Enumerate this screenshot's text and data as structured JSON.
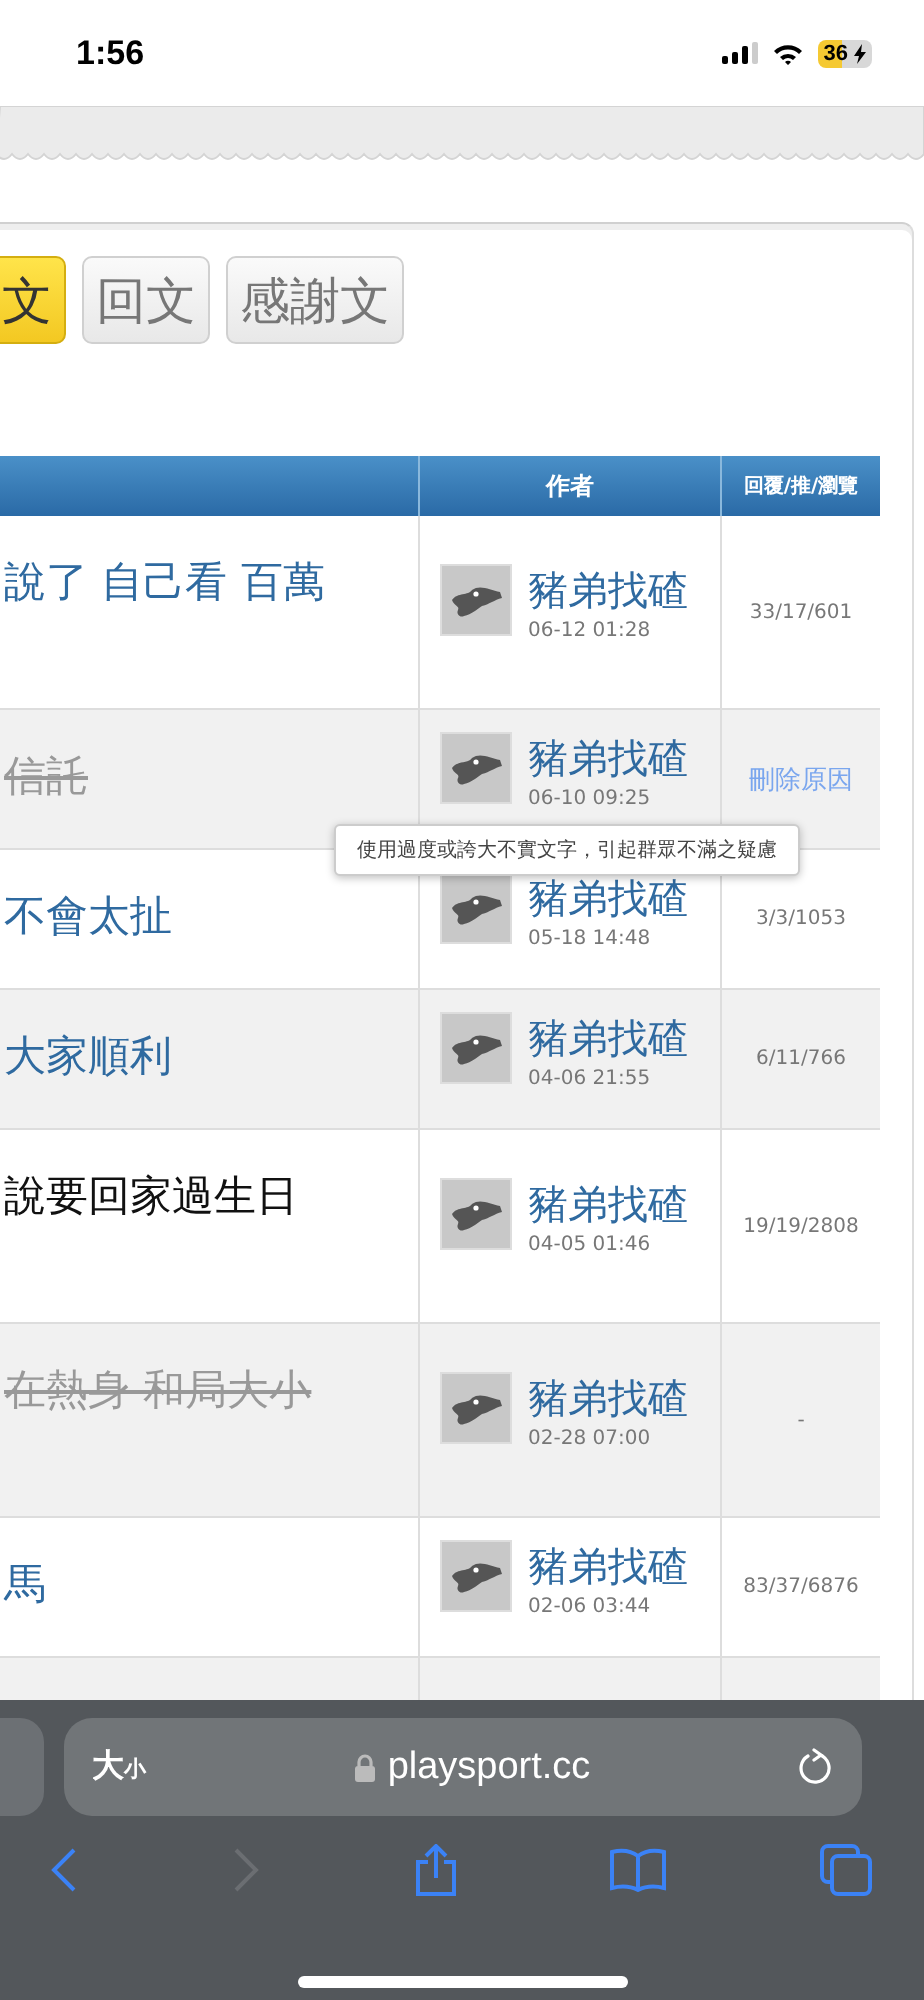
{
  "status_bar": {
    "time": "1:56",
    "battery": "36"
  },
  "tabs": [
    {
      "label": "文",
      "selected": true
    },
    {
      "label": "回文",
      "selected": false
    },
    {
      "label": "感謝文",
      "selected": false
    }
  ],
  "table": {
    "columns": [
      "作者",
      "回覆/推/瀏覽"
    ],
    "rows": [
      {
        "title": "說了 自己看 百萬",
        "kind": "link",
        "author": "豬弟找碴",
        "date": "06-12 01:28",
        "stats": "33/17/601"
      },
      {
        "title": "信託",
        "kind": "deleted",
        "author": "豬弟找碴",
        "date": "06-10 09:25",
        "delete_reason": "刪除原因"
      },
      {
        "title": "不會太扯",
        "kind": "link",
        "author": "豬弟找碴",
        "date": "05-18 14:48",
        "stats": "3/3/1053"
      },
      {
        "title": "大家順利",
        "kind": "link",
        "author": "豬弟找碴",
        "date": "04-06 21:55",
        "stats": "6/11/766"
      },
      {
        "title": "說要回家過生日",
        "kind": "visited",
        "author": "豬弟找碴",
        "date": "04-05 01:46",
        "stats": "19/19/2808"
      },
      {
        "title": "在熱身 和局大小",
        "kind": "deleted",
        "author": "豬弟找碴",
        "date": "02-28 07:00",
        "stats": "-"
      },
      {
        "title": "馬",
        "kind": "link",
        "author": "豬弟找碴",
        "date": "02-06 03:44",
        "stats": "83/37/6876"
      }
    ]
  },
  "tooltip": "使用過度或誇大不實文字，引起群眾不滿之疑慮",
  "browser": {
    "text_size": {
      "big": "大",
      "small": "小"
    },
    "url": "playsport.cc",
    "forward_disabled": true
  }
}
